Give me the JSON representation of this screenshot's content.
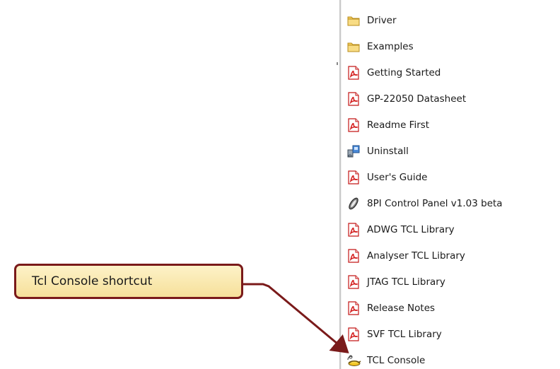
{
  "menu": {
    "items": [
      {
        "label": "Driver",
        "icon": "folder-icon"
      },
      {
        "label": "Examples",
        "icon": "folder-icon"
      },
      {
        "label": "Getting Started",
        "icon": "pdf-icon"
      },
      {
        "label": "GP-22050 Datasheet",
        "icon": "pdf-icon"
      },
      {
        "label": "Readme First",
        "icon": "pdf-icon"
      },
      {
        "label": "Uninstall",
        "icon": "uninstall-icon"
      },
      {
        "label": "User's Guide",
        "icon": "pdf-icon"
      },
      {
        "label": "8PI Control Panel v1.03 beta",
        "icon": "control-panel-icon"
      },
      {
        "label": "ADWG TCL Library",
        "icon": "pdf-icon"
      },
      {
        "label": "Analyser TCL Library",
        "icon": "pdf-icon"
      },
      {
        "label": "JTAG TCL Library",
        "icon": "pdf-icon"
      },
      {
        "label": "Release Notes",
        "icon": "pdf-icon"
      },
      {
        "label": "SVF TCL Library",
        "icon": "pdf-icon"
      },
      {
        "label": "TCL Console",
        "icon": "tcl-console-icon"
      }
    ]
  },
  "callout": {
    "text": "Tcl Console shortcut",
    "border_color": "#7a1a1a",
    "fill_color": "#f8e6a8"
  },
  "colors": {
    "folder": "#f3cc5c",
    "pdf": "#d42020",
    "arrow": "#7a1a1a"
  }
}
